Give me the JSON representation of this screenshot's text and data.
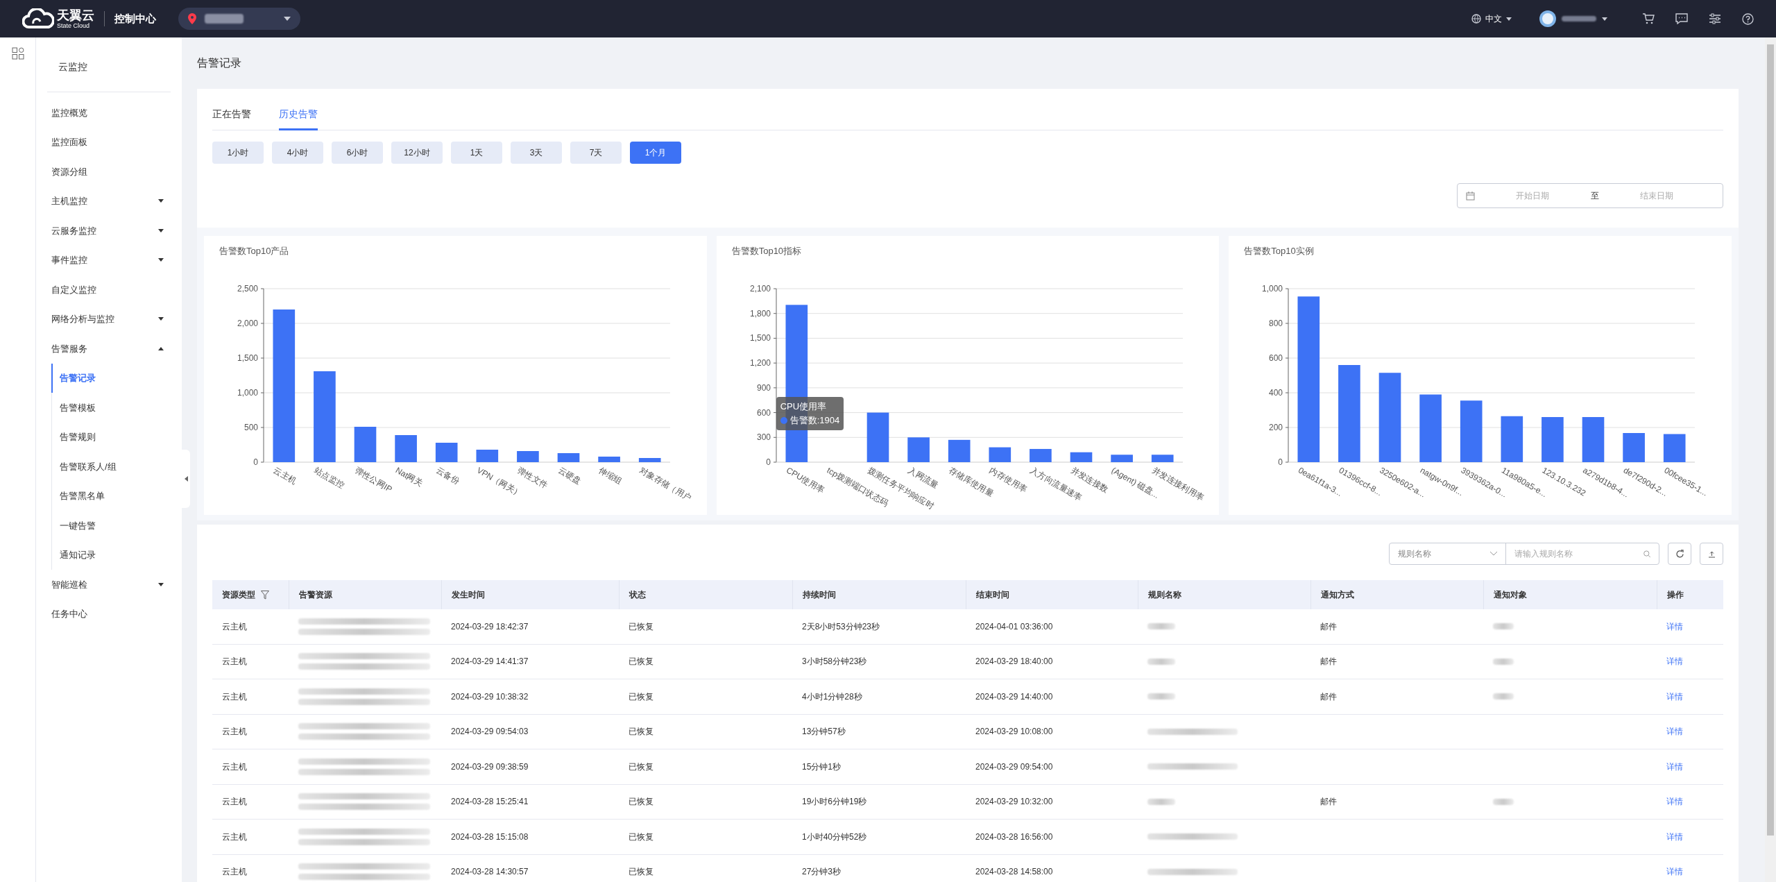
{
  "topbar": {
    "logo_main": "天翼云",
    "logo_sub": "State Cloud",
    "console": "控制中心",
    "region": {
      "redacted": true
    },
    "language": "中文",
    "user": {
      "redacted": true
    }
  },
  "sidebar": {
    "title": "云监控",
    "items": [
      {
        "label": "监控概览",
        "selected": false
      },
      {
        "label": "监控面板",
        "selected": false
      },
      {
        "label": "资源分组",
        "selected": false
      },
      {
        "label": "主机监控",
        "selected": false,
        "expanded": false
      },
      {
        "label": "云服务监控",
        "selected": false,
        "expanded": false
      },
      {
        "label": "事件监控",
        "selected": false,
        "expanded": false
      },
      {
        "label": "自定义监控",
        "selected": false
      },
      {
        "label": "网络分析与监控",
        "selected": false,
        "expanded": false
      },
      {
        "label": "告警服务",
        "selected": false,
        "expanded": true,
        "children": [
          {
            "label": "告警记录",
            "selected": true
          },
          {
            "label": "告警模板",
            "selected": false
          },
          {
            "label": "告警规则",
            "selected": false
          },
          {
            "label": "告警联系人/组",
            "selected": false
          },
          {
            "label": "告警黑名单",
            "selected": false
          },
          {
            "label": "一键告警",
            "selected": false
          },
          {
            "label": "通知记录",
            "selected": false
          }
        ]
      },
      {
        "label": "智能巡检",
        "selected": false,
        "expanded": false
      },
      {
        "label": "任务中心",
        "selected": false
      }
    ]
  },
  "page_title": "告警记录",
  "tabs": [
    {
      "label": "正在告警",
      "selected": false
    },
    {
      "label": "历史告警",
      "selected": true
    }
  ],
  "time_ranges": [
    {
      "label": "1小时",
      "selected": false
    },
    {
      "label": "4小时",
      "selected": false
    },
    {
      "label": "6小时",
      "selected": false
    },
    {
      "label": "12小时",
      "selected": false
    },
    {
      "label": "1天",
      "selected": false
    },
    {
      "label": "3天",
      "selected": false
    },
    {
      "label": "7天",
      "selected": false
    },
    {
      "label": "1个月",
      "selected": true
    }
  ],
  "date_range": {
    "start_placeholder": "开始日期",
    "separator": "至",
    "end_placeholder": "结束日期"
  },
  "charts": [
    {
      "chart_data": {
        "type": "bar",
        "title": "告警数Top10产品",
        "categories": [
          "云主机",
          "站点监控",
          "弹性公网IP",
          "Nat网关",
          "云备份",
          "VPN（网关）",
          "弹性文件",
          "云硬盘",
          "伸缩组",
          "对象存储（用户"
        ],
        "values": [
          2200,
          1310,
          510,
          390,
          280,
          180,
          160,
          130,
          80,
          60
        ],
        "grid": true,
        "ylim": [
          0,
          2500
        ],
        "yticks": [
          {
            "value": 0,
            "label": "0"
          },
          {
            "value": 500,
            "label": "500"
          },
          {
            "value": 1000,
            "label": "1,000"
          },
          {
            "value": 1500,
            "label": "1,500"
          },
          {
            "value": 2000,
            "label": "2,000"
          },
          {
            "value": 2500,
            "label": "2,500"
          }
        ]
      }
    },
    {
      "chart_data": {
        "type": "bar",
        "title": "告警数Top10指标",
        "categories": [
          "CPU使用率",
          "tcp拨测端口状态码",
          "拨测任务平均响应时",
          "入网流量",
          "存储库使用量",
          "内存使用率",
          "入方向流量速率",
          "并发连接数",
          "(Agent) 磁盘...",
          "并发连接利用率"
        ],
        "values": [
          1904,
          null,
          600,
          300,
          270,
          180,
          160,
          120,
          90,
          90
        ],
        "grid": true,
        "ylim": [
          0,
          2100
        ],
        "yticks": [
          {
            "value": 0,
            "label": "0"
          },
          {
            "value": 300,
            "label": "300"
          },
          {
            "value": 600,
            "label": "600"
          },
          {
            "value": 900,
            "label": "900"
          },
          {
            "value": 1200,
            "label": "1,200"
          },
          {
            "value": 1500,
            "label": "1,500"
          },
          {
            "value": 1800,
            "label": "1,800"
          },
          {
            "value": 2100,
            "label": "2,100"
          }
        ]
      },
      "tooltip": {
        "title": "CPU使用率",
        "label": "告警数:1904",
        "color": "#3d72f5"
      }
    },
    {
      "chart_data": {
        "type": "bar",
        "title": "告警数Top10实例",
        "categories": [
          "0ea61f1a-3...",
          "01396ccf-8...",
          "3250e602-a...",
          "natgw-0n9f...",
          "3939362a-0...",
          "11a980a5-e...",
          "123.10.3.232",
          "a279d1b8-4...",
          "de7f290d-2...",
          "00fcee35-1..."
        ],
        "values": [
          955,
          560,
          515,
          390,
          355,
          265,
          260,
          260,
          168,
          162
        ],
        "grid": true,
        "ylim": [
          0,
          1000
        ],
        "yticks": [
          {
            "value": 0,
            "label": "0"
          },
          {
            "value": 200,
            "label": "200"
          },
          {
            "value": 400,
            "label": "400"
          },
          {
            "value": 600,
            "label": "600"
          },
          {
            "value": 800,
            "label": "800"
          },
          {
            "value": 1000,
            "label": "1,000"
          }
        ]
      }
    }
  ],
  "filter": {
    "field": "规则名称",
    "placeholder": "请输入规则名称"
  },
  "table": {
    "columns": [
      "资源类型",
      "告警资源",
      "发生时间",
      "状态",
      "持续时间",
      "结束时间",
      "规则名称",
      "通知方式",
      "通知对象",
      "操作"
    ],
    "rows": [
      {
        "type": "云主机",
        "resource_redacted": true,
        "start": "2024-03-29 18:42:37",
        "status": "已恢复",
        "duration": "2天8小时53分钟23秒",
        "end": "2024-04-01 03:36:00",
        "rule_redacted": true,
        "notify": "邮件",
        "target_redacted": true,
        "action": "详情"
      },
      {
        "type": "云主机",
        "resource_redacted": true,
        "start": "2024-03-29 14:41:37",
        "status": "已恢复",
        "duration": "3小时58分钟23秒",
        "end": "2024-03-29 18:40:00",
        "rule_redacted": true,
        "notify": "邮件",
        "target_redacted": true,
        "action": "详情"
      },
      {
        "type": "云主机",
        "resource_redacted": true,
        "start": "2024-03-29 10:38:32",
        "status": "已恢复",
        "duration": "4小时1分钟28秒",
        "end": "2024-03-29 14:40:00",
        "rule_redacted": true,
        "notify": "邮件",
        "target_redacted": true,
        "action": "详情"
      },
      {
        "type": "云主机",
        "resource_redacted": true,
        "start": "2024-03-29 09:54:03",
        "status": "已恢复",
        "duration": "13分钟57秒",
        "end": "2024-03-29 10:08:00",
        "rule_redacted": true,
        "action": "详情"
      },
      {
        "type": "云主机",
        "resource_redacted": true,
        "start": "2024-03-29 09:38:59",
        "status": "已恢复",
        "duration": "15分钟1秒",
        "end": "2024-03-29 09:54:00",
        "rule_redacted": true,
        "action": "详情"
      },
      {
        "type": "云主机",
        "resource_redacted": true,
        "start": "2024-03-28 15:25:41",
        "status": "已恢复",
        "duration": "19小时6分钟19秒",
        "end": "2024-03-29 10:32:00",
        "rule_redacted": true,
        "notify": "邮件",
        "target_redacted": true,
        "action": "详情"
      },
      {
        "type": "云主机",
        "resource_redacted": true,
        "start": "2024-03-28 15:15:08",
        "status": "已恢复",
        "duration": "1小时40分钟52秒",
        "end": "2024-03-28 16:56:00",
        "rule_redacted": true,
        "action": "详情"
      },
      {
        "type": "云主机",
        "resource_redacted": true,
        "start": "2024-03-28 14:30:57",
        "status": "已恢复",
        "duration": "27分钟3秒",
        "end": "2024-03-28 14:58:00",
        "rule_redacted": true,
        "action": "详情"
      }
    ]
  }
}
